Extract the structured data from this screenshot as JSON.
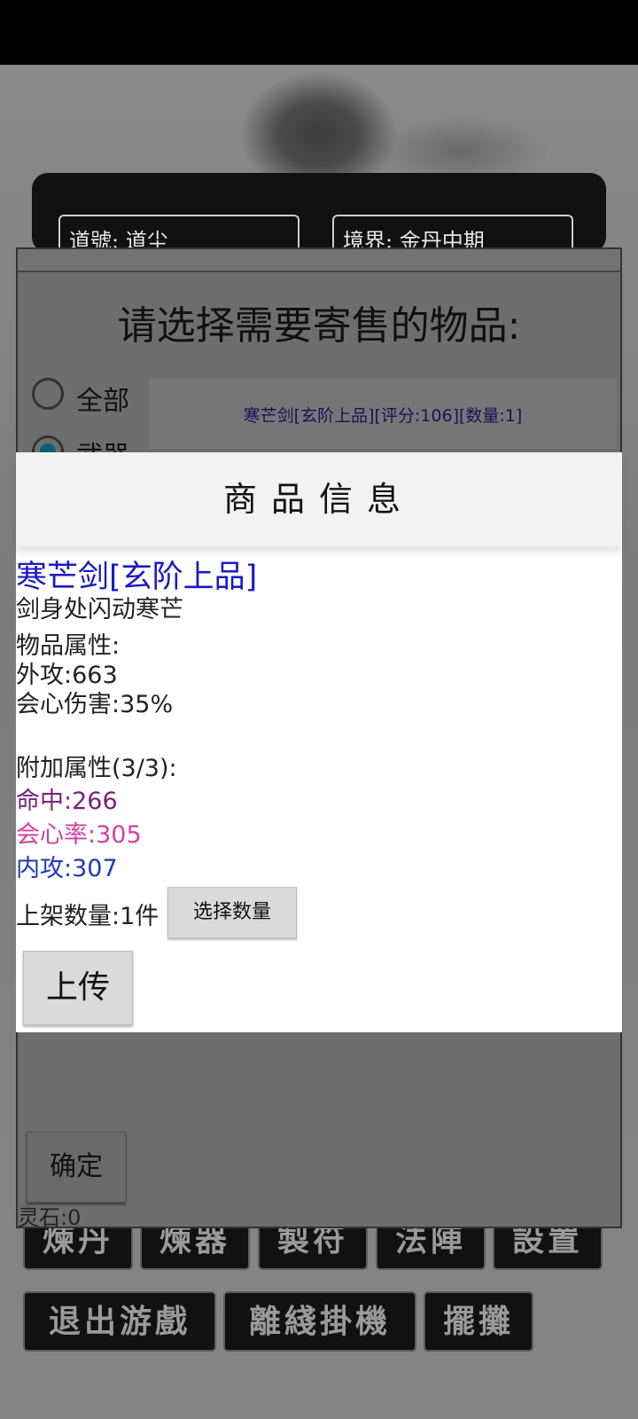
{
  "background": {
    "daohao": "道號: 道尘",
    "jingjie": "境界: 金丹中期",
    "lingshi": "灵石:0",
    "buttons_row1": [
      "煉丹",
      "煉器",
      "製符",
      "法陣",
      "設置"
    ],
    "buttons_row2": [
      "退出游戲",
      "離綫掛機",
      "擺攤"
    ]
  },
  "select_dialog": {
    "title": "请选择需要寄售的物品:",
    "radios": [
      {
        "label": "全部",
        "checked": false
      },
      {
        "label": "武器",
        "checked": true
      }
    ],
    "list_item": "寒芒剑[玄阶上品][评分:106][数量:1]",
    "confirm_label": "确定"
  },
  "product_dialog": {
    "header": "商品信息",
    "name": "寒芒剑[玄阶上品]",
    "description": "剑身处闪动寒芒",
    "attr_title": "物品属性:",
    "attrs": [
      "外攻:663",
      "会心伤害:35%"
    ],
    "extra_title": "附加属性(3/3):",
    "extra_attrs": [
      {
        "text": "命中:266",
        "color": "#7a1f7a"
      },
      {
        "text": "会心率:305",
        "color": "#d43fa0"
      },
      {
        "text": "内攻:307",
        "color": "#1a3ac0"
      }
    ],
    "quantity_label": "上架数量:1件",
    "select_qty_label": "选择数量",
    "upload_label": "上传"
  },
  "colors": {
    "item_name": "#1a1ac8",
    "list_item": "#14145a",
    "radio_checked": "#0b5f74"
  }
}
